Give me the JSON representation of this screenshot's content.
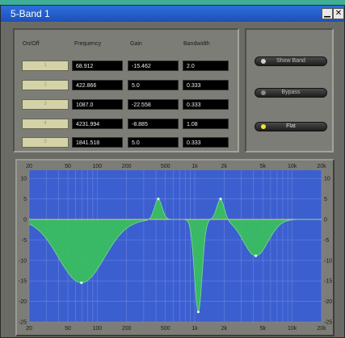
{
  "window": {
    "title": "5-Band 1",
    "minimize_icon": "minimize-icon",
    "close_icon": "close-icon"
  },
  "table": {
    "headers": {
      "onoff": "On/Off",
      "frequency": "Frequency",
      "gain": "Gain",
      "bandwidth": "Bandwidth"
    },
    "bands": [
      {
        "label": "1",
        "frequency": "68.912",
        "gain": "-15.462",
        "bandwidth": "2.0"
      },
      {
        "label": "2",
        "frequency": "422.866",
        "gain": "5.0",
        "bandwidth": "0.333"
      },
      {
        "label": "3",
        "frequency": "1087.0",
        "gain": "-22.558",
        "bandwidth": "0.333"
      },
      {
        "label": "4",
        "frequency": "4231.994",
        "gain": "-8.885",
        "bandwidth": "1.08"
      },
      {
        "label": "5",
        "frequency": "1841.518",
        "gain": "5.0",
        "bandwidth": "0.333"
      }
    ]
  },
  "side_buttons": [
    {
      "label": "Show Band",
      "led": "#cfcfcf"
    },
    {
      "label": "Bypass",
      "led": "#8a8a8a"
    },
    {
      "label": "Flat",
      "led": "#f2e23a"
    }
  ],
  "colors": {
    "plot_bg": "#3c5fd0",
    "grid": "#8fa0e6",
    "fill": "#38c25a",
    "curve": "#f2c27a"
  },
  "chart_data": {
    "type": "area",
    "x_scale": "log",
    "xlim": [
      20,
      20000
    ],
    "ylim": [
      -25,
      12
    ],
    "x_ticks": [
      {
        "v": 20,
        "label": "20"
      },
      {
        "v": 50,
        "label": "50"
      },
      {
        "v": 100,
        "label": "100"
      },
      {
        "v": 200,
        "label": "200"
      },
      {
        "v": 500,
        "label": "500"
      },
      {
        "v": 1000,
        "label": "1k"
      },
      {
        "v": 2000,
        "label": "2k"
      },
      {
        "v": 5000,
        "label": "5k"
      },
      {
        "v": 10000,
        "label": "10k"
      },
      {
        "v": 20000,
        "label": "20k"
      }
    ],
    "y_ticks": [
      10,
      5,
      0,
      -5,
      -10,
      -15,
      -20,
      -25
    ],
    "bands": [
      {
        "freq": 68.912,
        "gain": -15.462,
        "bw": 2.0
      },
      {
        "freq": 422.866,
        "gain": 5.0,
        "bw": 0.333
      },
      {
        "freq": 1087.0,
        "gain": -22.558,
        "bw": 0.333
      },
      {
        "freq": 4231.994,
        "gain": -8.885,
        "bw": 1.08
      },
      {
        "freq": 1841.518,
        "gain": 5.0,
        "bw": 0.333
      }
    ],
    "grid": true
  }
}
